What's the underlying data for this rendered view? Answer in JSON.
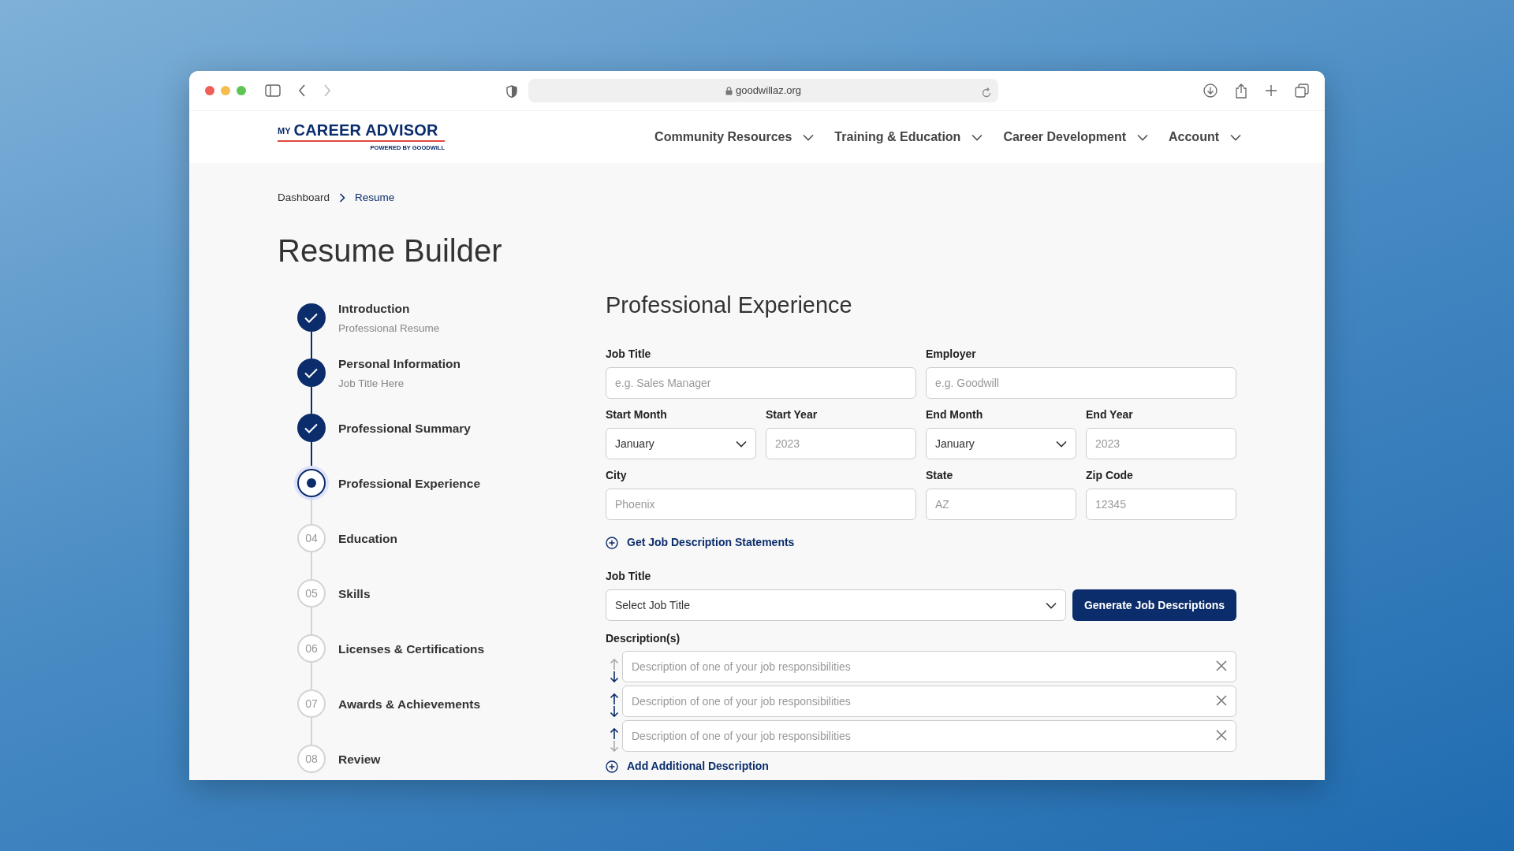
{
  "browser": {
    "url": "goodwillaz.org"
  },
  "logo": {
    "prefix": "MY",
    "name": "CAREER ADVISOR",
    "tagline": "POWERED BY GOODWILL"
  },
  "nav": [
    {
      "label": "Community Resources"
    },
    {
      "label": "Training & Education"
    },
    {
      "label": "Career Development"
    },
    {
      "label": "Account"
    }
  ],
  "breadcrumb": [
    {
      "label": "Dashboard",
      "current": false
    },
    {
      "label": "Resume",
      "current": true
    }
  ],
  "title": "Resume Builder",
  "steps": [
    {
      "completed": true,
      "current": false,
      "title": "Introduction",
      "subtitle": "Professional Resume"
    },
    {
      "completed": true,
      "current": false,
      "title": "Personal Information",
      "subtitle": "Job Title Here"
    },
    {
      "completed": true,
      "current": false,
      "title": "Professional Summary"
    },
    {
      "completed": false,
      "current": true,
      "title": "Professional Experience"
    },
    {
      "completed": false,
      "current": false,
      "number": "04",
      "title": "Education"
    },
    {
      "completed": false,
      "current": false,
      "number": "05",
      "title": "Skills"
    },
    {
      "completed": false,
      "current": false,
      "number": "06",
      "title": "Licenses & Certifications"
    },
    {
      "completed": false,
      "current": false,
      "number": "07",
      "title": "Awards & Achievements"
    },
    {
      "completed": false,
      "current": false,
      "number": "08",
      "title": "Review"
    }
  ],
  "form": {
    "title": "Professional Experience",
    "rows": [
      [
        {
          "fields": [
            {
              "kind": "text",
              "label": "Job Title",
              "placeholder": "e.g. Sales Manager"
            }
          ]
        },
        {
          "fields": [
            {
              "kind": "text",
              "label": "Employer",
              "placeholder": "e.g. Goodwill"
            }
          ]
        }
      ],
      [
        {
          "fields": [
            {
              "kind": "select",
              "label": "Start Month",
              "value": "January"
            },
            {
              "kind": "text",
              "label": "Start Year",
              "placeholder": "2023"
            }
          ]
        },
        {
          "fields": [
            {
              "kind": "select",
              "label": "End Month",
              "value": "January"
            },
            {
              "kind": "text",
              "label": "End Year",
              "placeholder": "2023"
            }
          ]
        }
      ],
      [
        {
          "fields": [
            {
              "kind": "text",
              "label": "City",
              "placeholder": "Phoenix"
            }
          ]
        },
        {
          "fields": [
            {
              "kind": "text",
              "label": "State",
              "placeholder": "AZ"
            },
            {
              "kind": "text",
              "label": "Zip Code",
              "placeholder": "12345"
            }
          ]
        }
      ]
    ],
    "statements_link": "Get Job Description Statements",
    "generator": {
      "label": "Job Title",
      "select": "Select Job Title",
      "button": "Generate Job Descriptions"
    },
    "descriptions": {
      "label": "Description(s)",
      "items": [
        {
          "placeholder": "Description of one of your job responsibilities",
          "up_enabled": false,
          "down_enabled": true
        },
        {
          "placeholder": "Description of one of your job responsibilities",
          "up_enabled": true,
          "down_enabled": true
        },
        {
          "placeholder": "Description of one of your job responsibilities",
          "up_enabled": true,
          "down_enabled": false
        }
      ]
    },
    "add_link": "Add Additional Description"
  }
}
